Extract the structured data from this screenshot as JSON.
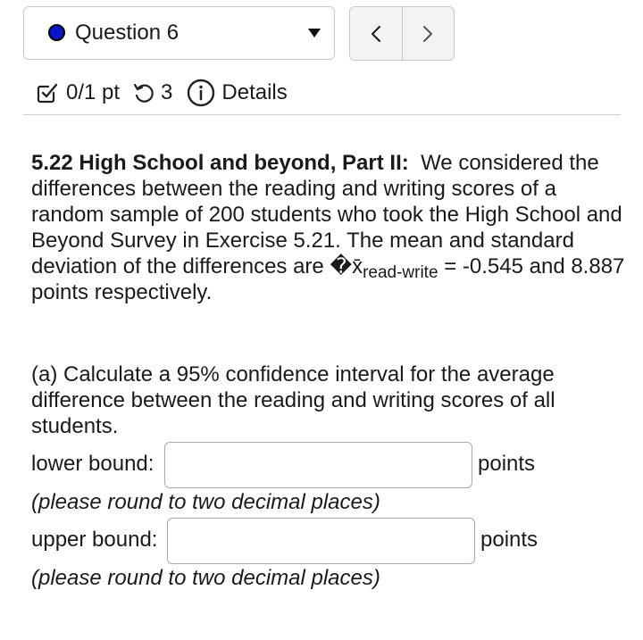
{
  "question_selector": {
    "label": "Question 6",
    "status_color": "#0a14c8"
  },
  "nav": {
    "prev_icon": "chevron-left-icon",
    "next_icon": "chevron-right-icon"
  },
  "meta": {
    "score": "0/1 pt",
    "attempts": "3",
    "details": "Details"
  },
  "problem": {
    "title": "5.22 High School and beyond, Part II:",
    "body": "We considered the differences between the reading and writing scores of a random sample of 200 students who took the High School and Beyond Survey in Exercise 5.21. The mean and standard deviation of the differences are",
    "mean_symbol": "�x̄",
    "mean_subscript": "read-write",
    "equals": "=",
    "values": "-0.545 and 8.887 points respectively."
  },
  "part_a": {
    "prompt": "(a) Calculate a 95% confidence interval for the average difference between the reading and writing scores of all students.",
    "lower": {
      "label": "lower bound:",
      "value": "",
      "unit": "points",
      "hint": "(please round to two decimal places)"
    },
    "upper": {
      "label": "upper bound:",
      "value": "",
      "unit": "points",
      "hint": "(please round to two decimal places)"
    }
  }
}
